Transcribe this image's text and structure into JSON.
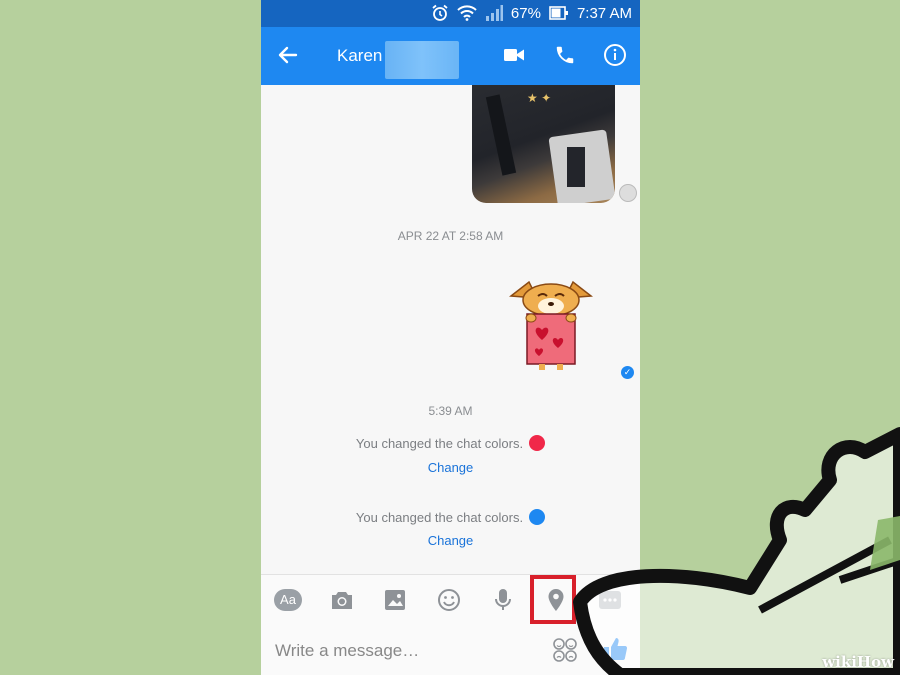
{
  "status_bar": {
    "battery": "67%",
    "time": "7:37 AM",
    "icons": [
      "alarm-icon",
      "wifi-icon",
      "signal-icon",
      "battery-icon"
    ]
  },
  "header": {
    "contact_name": "Karen",
    "back_icon": "back-arrow-icon",
    "actions": [
      "video-call-icon",
      "phone-call-icon",
      "info-icon"
    ]
  },
  "conversation": {
    "timestamp_1": "APR 22 AT 2:58 AM",
    "timestamp_2": "5:39 AM",
    "system_messages": [
      {
        "text": "You changed the chat colors.",
        "color": "#f02849",
        "action": "Change"
      },
      {
        "text": "You changed the chat colors.",
        "color": "#1e88f1",
        "action": "Change"
      }
    ]
  },
  "toolbar": {
    "text_mode_label": "Aa",
    "tools": [
      "text-format-icon",
      "camera-icon",
      "gallery-icon",
      "emoji-icon",
      "microphone-icon",
      "location-pin-icon",
      "more-icon"
    ],
    "highlighted_tool": "location-pin-icon"
  },
  "composer": {
    "placeholder": "Write a message…",
    "send_icon": "thumbs-up-icon"
  },
  "watermark": {
    "part1": "wiki",
    "part2": "How"
  },
  "colors": {
    "accent": "#1e88f1",
    "status_bar": "#1565c0",
    "highlight": "#d8202b",
    "background": "#b6d09d"
  }
}
